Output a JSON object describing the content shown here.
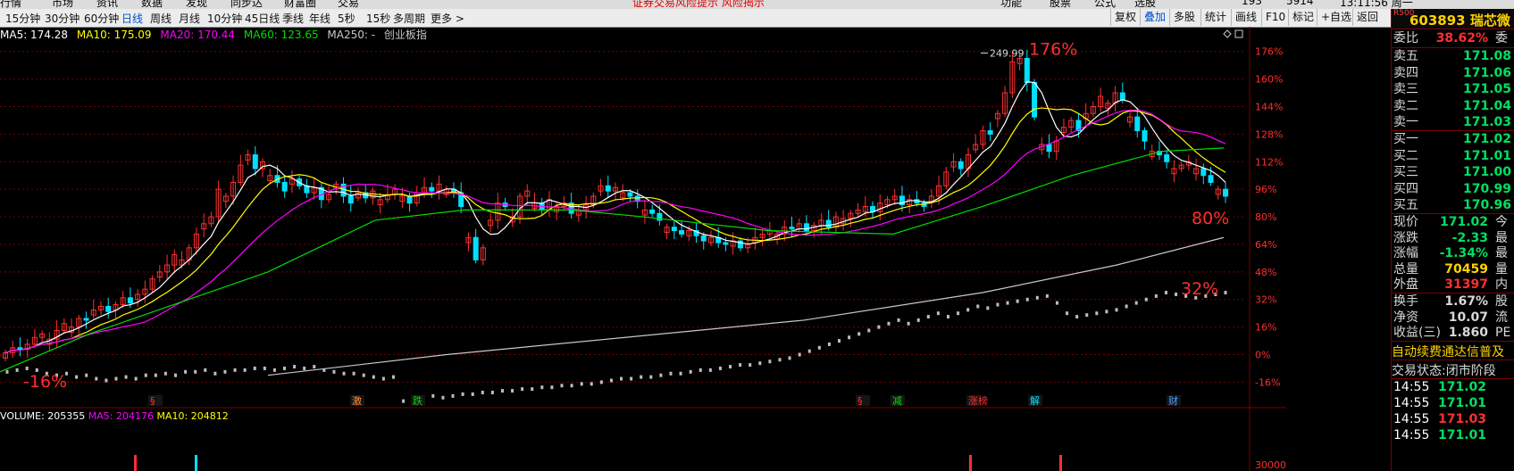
{
  "menu": {
    "items": [
      "行情",
      "市场",
      "资讯",
      "数据",
      "发现",
      "同步达",
      "财富圈",
      "交易",
      "功能",
      "股票",
      "公式",
      "选股"
    ],
    "notice": "证券交易风险提示  风险揭示",
    "tail": [
      "193",
      "5914",
      "13:11:56 周一"
    ]
  },
  "period_tabs": [
    "15分钟",
    "30分钟",
    "60分钟",
    "日线",
    "周线",
    "月线",
    "10分钟",
    "45日线",
    "季线",
    "年线",
    "5秒",
    "15秒",
    "多周期",
    "更多 >"
  ],
  "active_period": "日线",
  "toolbar": [
    "复权",
    "叠加",
    "多股",
    "统计",
    "画线",
    "F10",
    "标记",
    "+自选",
    "返回"
  ],
  "ma_line": {
    "ma5": "MA5: 174.28",
    "ma10": "MA10: 175.09",
    "ma20": "MA20: 170.44",
    "ma60": "MA60: 123.65",
    "ma250": "MA250: -",
    "overlay": "创业板指"
  },
  "colors": {
    "ma5": "#ffffff",
    "ma10": "#ffff00",
    "ma20": "#ff00ff",
    "ma60": "#00dd00",
    "ma250": "#c8c8c8",
    "up": "#ff3030",
    "down": "#00e0ff",
    "grid": "#7a0000",
    "axis": "#ff2e2e"
  },
  "chart_data": {
    "type": "candlestick",
    "y_axis_labels": [
      "176%",
      "160%",
      "144%",
      "128%",
      "112%",
      "96%",
      "80%",
      "64%",
      "48%",
      "32%",
      "16%",
      "0%",
      "-16%"
    ],
    "y_axis_values": [
      176,
      160,
      144,
      128,
      112,
      96,
      80,
      64,
      48,
      32,
      16,
      0,
      -16
    ],
    "ylim": [
      -22,
      180
    ],
    "peak_label": "249.99",
    "annotations": [
      {
        "text": "176%",
        "position": "near-peak"
      },
      {
        "text": "80%",
        "position": "right-side"
      },
      {
        "text": "32%",
        "position": "right-side-lower"
      },
      {
        "text": "-16%",
        "position": "left-bottom"
      }
    ],
    "close_series": [
      1,
      4,
      3,
      6,
      10,
      12,
      9,
      14,
      18,
      16,
      21,
      20,
      26,
      28,
      25,
      29,
      33,
      30,
      35,
      38,
      44,
      48,
      52,
      58,
      55,
      62,
      70,
      76,
      80,
      96,
      92,
      100,
      110,
      116,
      108,
      112,
      104,
      100,
      95,
      102,
      98,
      94,
      97,
      90,
      93,
      99,
      92,
      88,
      94,
      91,
      95,
      90,
      93,
      96,
      92,
      88,
      94,
      97,
      95,
      99,
      96,
      94,
      86,
      68,
      55,
      62,
      78,
      88,
      86,
      80,
      92,
      95,
      88,
      84,
      90,
      86,
      88,
      82,
      84,
      87,
      92,
      98,
      95,
      97,
      94,
      92,
      89,
      84,
      82,
      78,
      74,
      72,
      70,
      72,
      69,
      66,
      68,
      65,
      64,
      66,
      62,
      64,
      68,
      70,
      72,
      70,
      74,
      73,
      76,
      72,
      75,
      78,
      74,
      80,
      79,
      82,
      84,
      86,
      83,
      88,
      90,
      92,
      87,
      90,
      88,
      86,
      92,
      98,
      106,
      112,
      108,
      116,
      122,
      130,
      128,
      140,
      152,
      170,
      172,
      158,
      138,
      122,
      118,
      124,
      132,
      136,
      130,
      140,
      144,
      150,
      146,
      152,
      148,
      138,
      130,
      124,
      118,
      116,
      112,
      108,
      110,
      112,
      108,
      104,
      100,
      96,
      92
    ],
    "compare_series": [
      -10,
      -9,
      -8,
      -9,
      -11,
      -12,
      -11,
      -13,
      -12,
      -14,
      -15,
      -14,
      -13,
      -14,
      -12,
      -12,
      -11,
      -12,
      -10,
      -10,
      -9,
      -11,
      -10,
      -9,
      -9,
      -8,
      -8,
      -9,
      -8,
      -7,
      -8,
      -7,
      -9,
      -10,
      -11,
      -11,
      -12,
      -13,
      -14,
      -13,
      -27,
      -28,
      -26,
      -24,
      -25,
      -24,
      -23,
      -23,
      -22,
      -22,
      -21,
      -21,
      -20,
      -20,
      -19,
      -19,
      -18,
      -18,
      -17,
      -17,
      -16,
      -15,
      -14,
      -14,
      -13,
      -13,
      -12,
      -11,
      -11,
      -10,
      -9,
      -9,
      -8,
      -7,
      -6,
      -6,
      -5,
      -4,
      -3,
      -2,
      0,
      2,
      4,
      6,
      8,
      10,
      12,
      14,
      16,
      18,
      20,
      18,
      20,
      22,
      24,
      22,
      24,
      26,
      28,
      27,
      29,
      30,
      31,
      32,
      33,
      34,
      30,
      24,
      22,
      23,
      24,
      25,
      26,
      28,
      30,
      32,
      34,
      36,
      35,
      34,
      33,
      34,
      35,
      36
    ],
    "ma_curves": {
      "ma250": [
        [
          300,
          -12
        ],
        [
          500,
          0
        ],
        [
          700,
          10
        ],
        [
          900,
          20
        ],
        [
          1100,
          36
        ],
        [
          1250,
          52
        ],
        [
          1370,
          68
        ]
      ],
      "ma60": [
        [
          0,
          -10
        ],
        [
          100,
          12
        ],
        [
          200,
          30
        ],
        [
          300,
          48
        ],
        [
          420,
          78
        ],
        [
          520,
          84
        ],
        [
          640,
          84
        ],
        [
          720,
          80
        ],
        [
          860,
          72
        ],
        [
          1000,
          70
        ],
        [
          1100,
          86
        ],
        [
          1200,
          104
        ],
        [
          1300,
          118
        ],
        [
          1370,
          120
        ]
      ]
    },
    "events": [
      {
        "text": "§",
        "x": 172,
        "color": "#ff3030"
      },
      {
        "text": "激",
        "x": 398,
        "color": "#ff9040"
      },
      {
        "text": "跌",
        "x": 466,
        "color": "#00dd00"
      },
      {
        "text": "§",
        "x": 964,
        "color": "#ff3030"
      },
      {
        "text": "减",
        "x": 1003,
        "color": "#00dd00"
      },
      {
        "text": "涨榜",
        "x": 1088,
        "color": "#ff3030"
      },
      {
        "text": "解",
        "x": 1157,
        "color": "#00e0ff"
      },
      {
        "text": "财",
        "x": 1312,
        "color": "#4aa0ff"
      }
    ],
    "volume_line": {
      "vol": "VOLUME: 205355",
      "ma5": "MA5: 204176",
      "ma10": "MA10: 204812"
    },
    "volume_axis_label": "30000"
  },
  "panel": {
    "code": "603893",
    "name": "瑞芯微",
    "r500": "R500",
    "weibi": {
      "label": "委比",
      "value": "38.62%",
      "ext": "委"
    },
    "asks": [
      {
        "label": "卖五",
        "price": "171.08"
      },
      {
        "label": "卖四",
        "price": "171.06"
      },
      {
        "label": "卖三",
        "price": "171.05"
      },
      {
        "label": "卖二",
        "price": "171.04"
      },
      {
        "label": "卖一",
        "price": "171.03"
      }
    ],
    "bids": [
      {
        "label": "买一",
        "price": "171.02"
      },
      {
        "label": "买二",
        "price": "171.01"
      },
      {
        "label": "买三",
        "price": "171.00"
      },
      {
        "label": "买四",
        "price": "170.99"
      },
      {
        "label": "买五",
        "price": "170.96"
      }
    ],
    "stats": [
      {
        "label": "现价",
        "value": "171.02",
        "ext": "今",
        "color": "#00e060"
      },
      {
        "label": "涨跌",
        "value": "-2.33",
        "ext": "最",
        "color": "#00e060"
      },
      {
        "label": "涨幅",
        "value": "-1.34%",
        "ext": "最",
        "color": "#00e060"
      },
      {
        "label": "总量",
        "value": "70459",
        "ext": "量",
        "color": "#ffd200"
      },
      {
        "label": "外盘",
        "value": "31397",
        "ext": "内",
        "color": "#ff3030"
      }
    ],
    "stats2": [
      {
        "label": "换手",
        "value": "1.67%",
        "ext": "股",
        "color": "#d8d8d8"
      },
      {
        "label": "净资",
        "value": "10.07",
        "ext": "流",
        "color": "#d8d8d8"
      },
      {
        "label": "收益(三)",
        "value": "1.860",
        "ext": "PE",
        "color": "#d8d8d8"
      }
    ],
    "concepts": "自动续费通达信普及",
    "trade_status": "交易状态:闭市阶段",
    "ticks": [
      {
        "time": "14:55",
        "price": "171.02"
      },
      {
        "time": "14:55",
        "price": "171.01"
      },
      {
        "time": "14:55",
        "price": "171.03"
      },
      {
        "time": "14:55",
        "price": "171.01"
      }
    ]
  }
}
